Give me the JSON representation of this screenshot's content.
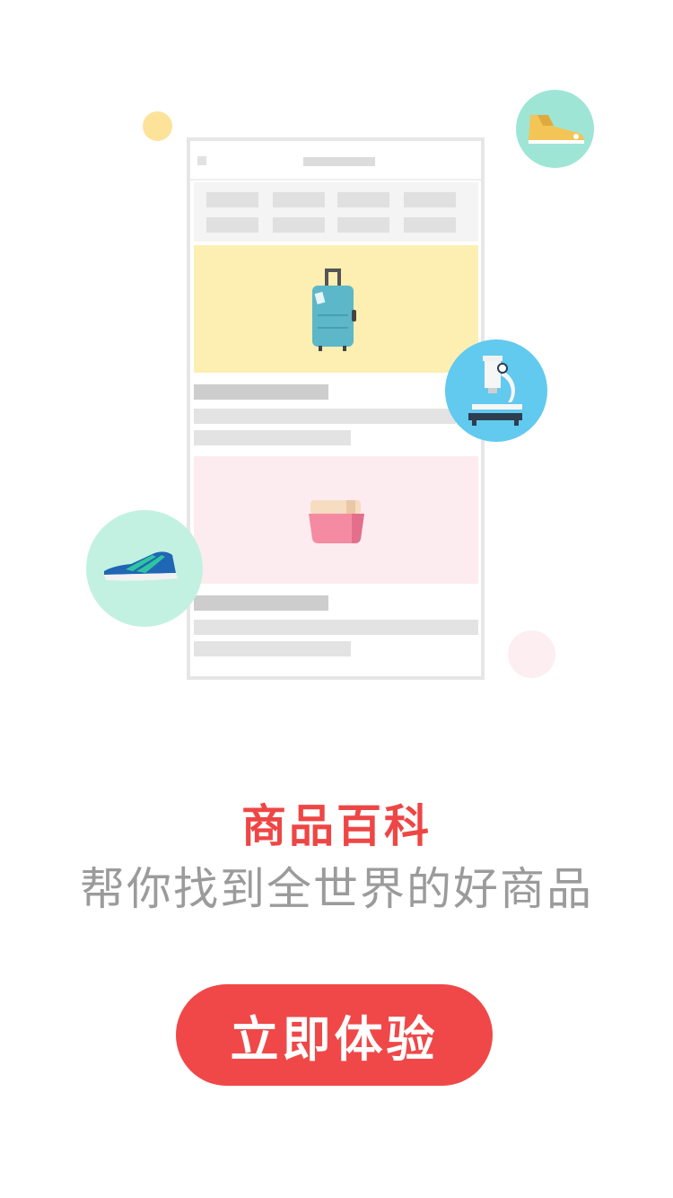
{
  "title": "商品百科",
  "subtitle": "帮你找到全世界的好商品",
  "cta_label": "立即体验",
  "colors": {
    "accent": "#f04848",
    "title": "#ee4645",
    "subtitle": "#9b9b9b",
    "card_yellow": "#fdefb2",
    "card_pink": "#fdecef",
    "circle_teal": "#9ee5d6",
    "circle_blue": "#62c9ef",
    "circle_mint": "#c2f1e1",
    "dot_yellow": "#fde29a",
    "dot_pink": "#fdeef1"
  },
  "illustration": {
    "items": [
      "suitcase-icon",
      "cream-jar-icon",
      "sneaker-icon",
      "microscope-icon",
      "running-shoe-icon"
    ]
  }
}
